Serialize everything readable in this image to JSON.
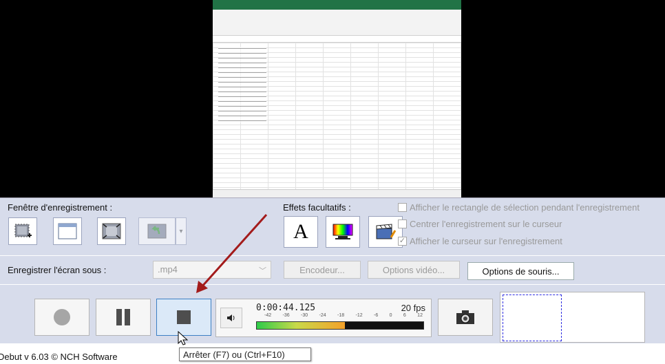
{
  "capture_labels": {
    "recording_window": "Fenêtre d'enregistrement :",
    "optional_effects": "Effets facultatifs :"
  },
  "effects_options": [
    {
      "label": "Afficher le rectangle de sélection pendant l'enregistrement",
      "checked": false,
      "enabled": false
    },
    {
      "label": "Centrer l'enregistrement sur le curseur",
      "checked": false,
      "enabled": true
    },
    {
      "label": "Afficher le curseur sur l'enregistrement",
      "checked": true,
      "enabled": true
    }
  ],
  "text_tool_glyph": "A",
  "save": {
    "label": "Enregistrer l'écran sous :",
    "format": ".mp4",
    "encoder_button": "Encodeur...",
    "video_options_button": "Options vidéo...",
    "mouse_options_button": "Options de souris..."
  },
  "recording": {
    "elapsed": "0:00:44.125",
    "fps": "20 fps",
    "meter_ticks": [
      "-42",
      "-36",
      "-30",
      "-24",
      "-18",
      "-12",
      "-6",
      "0",
      "6",
      "12"
    ],
    "level_fraction": 0.53
  },
  "footer": {
    "version": "Debut v 6.03 © NCH Software",
    "tooltip": "Arrêter (F7) ou (Ctrl+F10)"
  },
  "colors": {
    "panel_bg": "#d7dceb",
    "arrow": "#a31b1b",
    "stop_hover_border": "#3c7fc4",
    "excel_green": "#217346"
  }
}
